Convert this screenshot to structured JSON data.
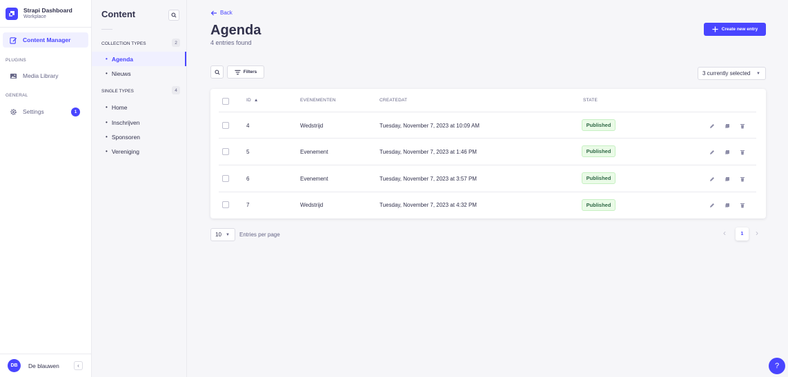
{
  "brand": {
    "title": "Strapi Dashboard",
    "subtitle": "Workplace"
  },
  "mainnav": {
    "content_manager": "Content Manager",
    "plugins_section": "PLUGINS",
    "media_library": "Media Library",
    "general_section": "GENERAL",
    "settings": "Settings",
    "settings_badge": "1"
  },
  "user": {
    "initials": "DB",
    "name": "De blauwen"
  },
  "subnav": {
    "title": "Content",
    "collection_types": {
      "label": "COLLECTION TYPES",
      "count": "2",
      "items": [
        "Agenda",
        "Nieuws"
      ]
    },
    "single_types": {
      "label": "SINGLE TYPES",
      "count": "4",
      "items": [
        "Home",
        "Inschrijven",
        "Sponsoren",
        "Vereniging"
      ]
    }
  },
  "header": {
    "back": "Back",
    "title": "Agenda",
    "subtitle": "4 entries found",
    "create_button": "Create new entry"
  },
  "toolbar": {
    "filters": "Filters",
    "columns_selected": "3 currently selected"
  },
  "table": {
    "columns": [
      "ID",
      "EVENEMENTEN",
      "CREATEDAT",
      "STATE"
    ],
    "rows": [
      {
        "id": "4",
        "evenementen": "Wedstrijd",
        "createdat": "Tuesday, November 7, 2023 at 10:09 AM",
        "state": "Published"
      },
      {
        "id": "5",
        "evenementen": "Evenement",
        "createdat": "Tuesday, November 7, 2023 at 1:46 PM",
        "state": "Published"
      },
      {
        "id": "6",
        "evenementen": "Evenement",
        "createdat": "Tuesday, November 7, 2023 at 3:57 PM",
        "state": "Published"
      },
      {
        "id": "7",
        "evenementen": "Wedstrijd",
        "createdat": "Tuesday, November 7, 2023 at 4:32 PM",
        "state": "Published"
      }
    ]
  },
  "pagination": {
    "per_page": "10",
    "per_page_label": "Entries per page",
    "current_page": "1"
  },
  "help": "?",
  "colors": {
    "accent": "#4945ff",
    "published_bg": "#eafbe7",
    "published_text": "#2f6846"
  }
}
